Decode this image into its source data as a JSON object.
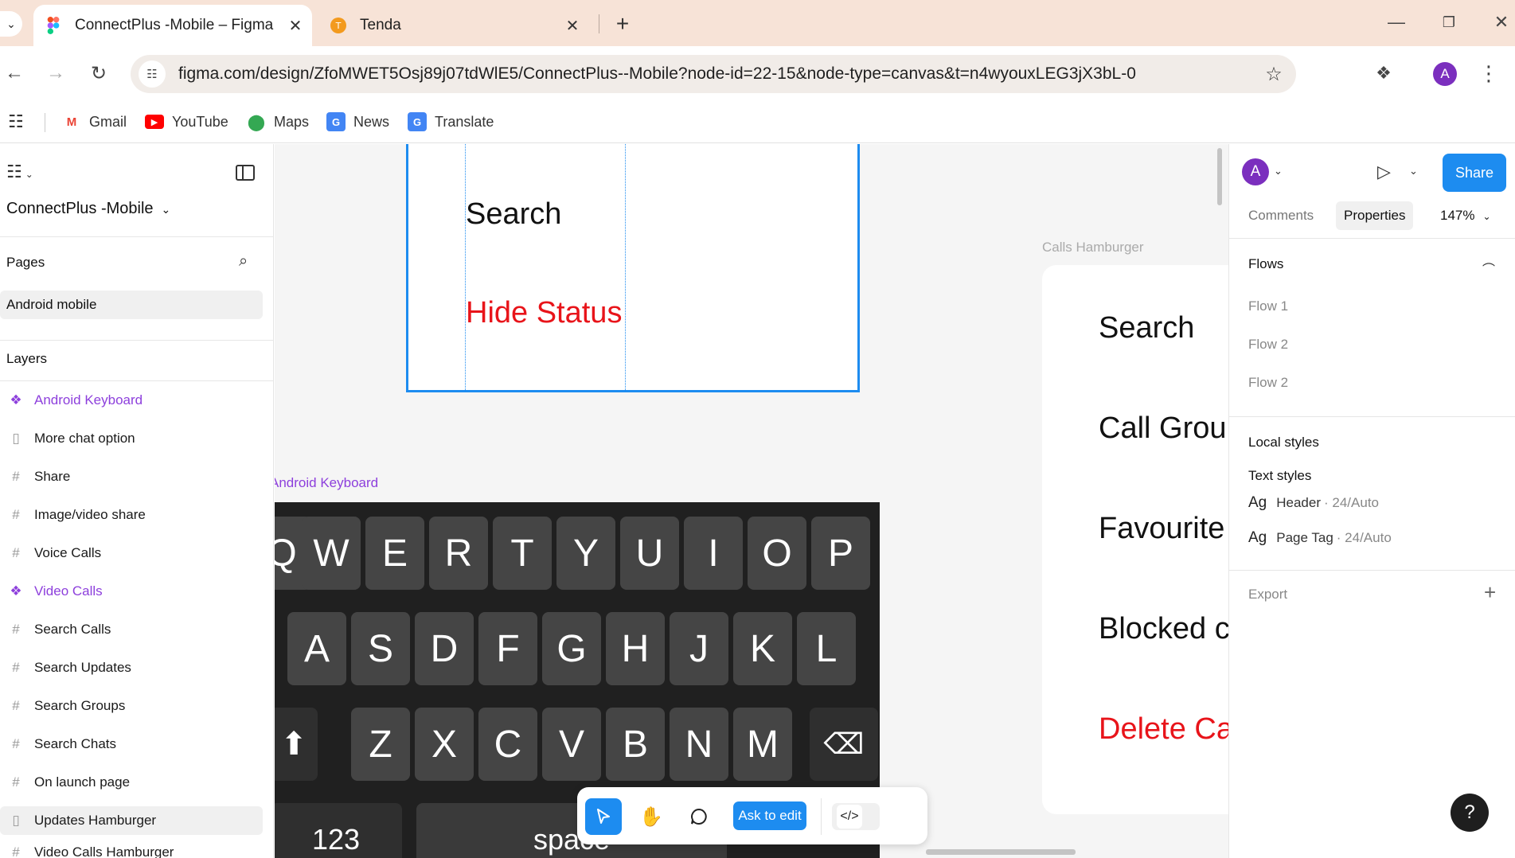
{
  "browser": {
    "tabs": [
      {
        "title": "ConnectPlus -Mobile – Figma",
        "icon": "figma-icon"
      },
      {
        "title": "Tenda",
        "icon": "tenda-icon"
      }
    ],
    "url": "figma.com/design/ZfoMWET5Osj89j07tdWlE5/ConnectPlus--Mobile?node-id=22-15&node-type=canvas&t=n4wyouxLEG3jX3bL-0",
    "profile_initial": "A",
    "bookmarks": [
      {
        "label": "Gmail",
        "color": "#ea4335",
        "glyph": "M"
      },
      {
        "label": "YouTube",
        "color": "#ff0000",
        "glyph": "▶"
      },
      {
        "label": "Maps",
        "color": "#34a853",
        "glyph": "⬤"
      },
      {
        "label": "News",
        "color": "#4285f4",
        "glyph": "G"
      },
      {
        "label": "Translate",
        "color": "#4285f4",
        "glyph": "G"
      }
    ]
  },
  "left_panel": {
    "file_name": "ConnectPlus -Mobile",
    "pages_heading": "Pages",
    "current_page": "Android mobile",
    "layers_heading": "Layers",
    "layers": [
      {
        "label": "Android Keyboard",
        "kind": "component"
      },
      {
        "label": "More chat option",
        "kind": "section"
      },
      {
        "label": "Share",
        "kind": "frame"
      },
      {
        "label": "Image/video share",
        "kind": "frame"
      },
      {
        "label": "Voice Calls",
        "kind": "frame"
      },
      {
        "label": "Video Calls",
        "kind": "component"
      },
      {
        "label": "Search Calls",
        "kind": "frame"
      },
      {
        "label": "Search Updates",
        "kind": "frame"
      },
      {
        "label": "Search Groups",
        "kind": "frame"
      },
      {
        "label": "Search Chats",
        "kind": "frame"
      },
      {
        "label": "On launch page",
        "kind": "frame"
      },
      {
        "label": "Updates Hamburger",
        "kind": "section"
      },
      {
        "label": "Video Calls Hamburger",
        "kind": "frame"
      }
    ]
  },
  "canvas": {
    "frame1": {
      "items": [
        "Search",
        "Hide Status"
      ]
    },
    "keyboard_label": "Android Keyboard",
    "keyboard": {
      "row1": [
        "Q",
        "W",
        "E",
        "R",
        "T",
        "Y",
        "U",
        "I",
        "O",
        "P"
      ],
      "row2": [
        "A",
        "S",
        "D",
        "F",
        "G",
        "H",
        "J",
        "K",
        "L"
      ],
      "row3": [
        "Z",
        "X",
        "C",
        "V",
        "B",
        "N",
        "M"
      ],
      "num_key": "123",
      "space_key": "space"
    },
    "frame2_label": "Calls Hamburger",
    "frame2": {
      "items": [
        "Search",
        "Call Grou",
        "Favourite",
        "Blocked c",
        "Delete Ca"
      ]
    },
    "toolbar": {
      "ask_to_edit": "Ask to edit",
      "code_glyph": "</>"
    }
  },
  "right_panel": {
    "avatar_initial": "A",
    "share_label": "Share",
    "tabs": [
      "Comments",
      "Properties"
    ],
    "zoom": "147%",
    "flows_heading": "Flows",
    "flows": [
      "Flow 1",
      "Flow 2",
      "Flow 2"
    ],
    "local_styles_heading": "Local styles",
    "text_styles_heading": "Text styles",
    "text_styles": [
      {
        "name": "Header",
        "meta": "· 24/Auto"
      },
      {
        "name": "Page Tag",
        "meta": "· 24/Auto"
      }
    ],
    "export_heading": "Export",
    "help_glyph": "?"
  }
}
